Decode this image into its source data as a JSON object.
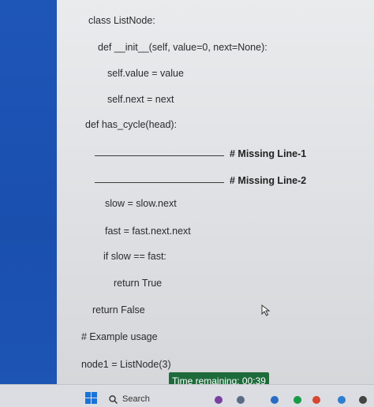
{
  "code": {
    "class_def": "class ListNode:",
    "init_def": "def __init__(self, value=0, next=None):",
    "self_value": "self.value = value",
    "self_next": "self.next = next",
    "has_cycle_def": "def has_cycle(head):",
    "missing_line_1": "# Missing Line-1",
    "missing_line_2": "# Missing Line-2",
    "slow_assign": "slow = slow.next",
    "fast_assign": "fast = fast.next.next",
    "if_check": "if slow == fast:",
    "return_true": "return True",
    "return_false": "return False",
    "comment_example": "# Example usage",
    "node1_assign": "node1 = ListNode(3)"
  },
  "timer": {
    "text": "Time remaining: 00:39"
  },
  "taskbar": {
    "search_label": "Search"
  },
  "icons": {
    "start": "windows-start-icon",
    "search": "search-icon",
    "cursor": "mouse-pointer-icon"
  },
  "colors": {
    "side_panel": "#1e56b8",
    "timer_bg": "#1d6b3a",
    "start_icon": "#1a73d6"
  }
}
